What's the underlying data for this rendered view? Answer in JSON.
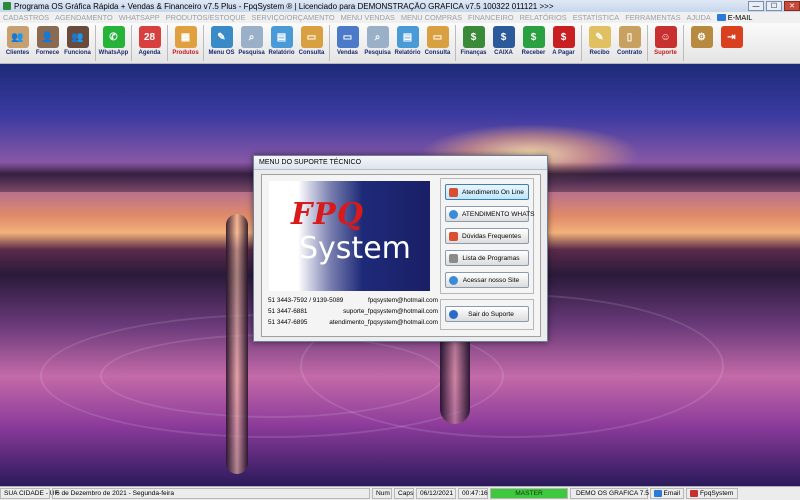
{
  "window": {
    "title": "Programa OS Gráfica Rápida + Vendas & Financeiro v7.5 Plus - FpqSystem ® | Licenciado para  DEMONSTRAÇÃO GRAFICA v7.5 100322 011121 >>>",
    "min_label": "—",
    "max_label": "☐",
    "close_label": "✕"
  },
  "menu": {
    "items": [
      "CADASTROS",
      "AGENDAMENTO",
      "WHATSAPP",
      "PRODUTOS/ESTOQUE",
      "SERVIÇO/ORÇAMENTO",
      "MENU VENDAS",
      "MENU COMPRAS",
      "FINANCEIRO",
      "RELATÓRIOS",
      "ESTATÍSTICA",
      "FERRAMENTAS",
      "AJUDA"
    ],
    "email_label": "E-MAIL"
  },
  "toolbar": {
    "buttons": [
      {
        "label": "Clientes",
        "icon": "clients-icon",
        "color": "#c8a070",
        "glyph": "👥",
        "red": false
      },
      {
        "label": "Fornece",
        "icon": "suppliers-icon",
        "color": "#8a6a50",
        "glyph": "👤",
        "red": false
      },
      {
        "label": "Funciona",
        "icon": "employees-icon",
        "color": "#6a4a3a",
        "glyph": "👥",
        "red": false
      },
      {
        "label": "WhatsApp",
        "icon": "whatsapp-icon",
        "color": "#25b33a",
        "glyph": "✆",
        "red": false
      },
      {
        "label": "Agenda",
        "icon": "calendar-icon",
        "color": "#d84040",
        "glyph": "28",
        "red": false
      },
      {
        "label": "Produtos",
        "icon": "products-icon",
        "color": "#e0a040",
        "glyph": "▦",
        "red": true
      },
      {
        "label": "Menu OS",
        "icon": "service-order-icon",
        "color": "#3a8ac8",
        "glyph": "✎",
        "red": false
      },
      {
        "label": "Pesquisa",
        "icon": "search-doc-icon",
        "color": "#9ab0c8",
        "glyph": "⌕",
        "red": false
      },
      {
        "label": "Relatório",
        "icon": "report-icon",
        "color": "#4a9ad8",
        "glyph": "▤",
        "red": false
      },
      {
        "label": "Consulta",
        "icon": "folder-icon",
        "color": "#d8a040",
        "glyph": "▭",
        "red": false
      },
      {
        "label": "Vendas",
        "icon": "sales-monitor-icon",
        "color": "#4a7ac8",
        "glyph": "▭",
        "red": false
      },
      {
        "label": "Pesquisa",
        "icon": "search-doc-icon",
        "color": "#9ab0c8",
        "glyph": "⌕",
        "red": false
      },
      {
        "label": "Relatório",
        "icon": "report-icon",
        "color": "#4a9ad8",
        "glyph": "▤",
        "red": false
      },
      {
        "label": "Consulta",
        "icon": "folder-icon",
        "color": "#d8a040",
        "glyph": "▭",
        "red": false
      },
      {
        "label": "Finanças",
        "icon": "finance-globe-icon",
        "color": "#3a8a3a",
        "glyph": "$",
        "red": false
      },
      {
        "label": "CAIXA",
        "icon": "cash-register-icon",
        "color": "#2a5a9a",
        "glyph": "$",
        "red": false
      },
      {
        "label": "Receber",
        "icon": "receive-money-icon",
        "color": "#2aa040",
        "glyph": "$",
        "red": false
      },
      {
        "label": "A Pagar",
        "icon": "pay-money-icon",
        "color": "#c82020",
        "glyph": "$",
        "red": false
      },
      {
        "label": "Recibo",
        "icon": "receipt-icon",
        "color": "#e0c060",
        "glyph": "✎",
        "red": false
      },
      {
        "label": "Contrato",
        "icon": "contract-scroll-icon",
        "color": "#c8a060",
        "glyph": "▯",
        "red": false
      },
      {
        "label": "Suporte",
        "icon": "support-icon",
        "color": "#c83030",
        "glyph": "☺",
        "red": true
      },
      {
        "label": "",
        "icon": "settings-coin-icon",
        "color": "#b88a40",
        "glyph": "⚙",
        "red": false
      },
      {
        "label": "",
        "icon": "exit-door-icon",
        "color": "#d84020",
        "glyph": "⇥",
        "red": false
      }
    ]
  },
  "dialog": {
    "title": "MENU DO SUPORTE TÉCNICO",
    "logo_top": "FPQ",
    "logo_bottom": "System",
    "contacts": [
      {
        "phone": "51 3443-7592 / 9139-5089",
        "email": "fpqsystem@hotmail.com"
      },
      {
        "phone": "51 3447-6881",
        "email": "suporte_fpqsystem@hotmail.com"
      },
      {
        "phone": "51 3447-6895",
        "email": "atendimento_fpqsystem@hotmail.com"
      }
    ],
    "buttons": [
      {
        "label": "Atendimento On Line",
        "icon": "online-support-icon",
        "color": "#d85030"
      },
      {
        "label": "ATENDIMENTO WHATS",
        "icon": "chat-bubble-icon",
        "color": "#3a8ad8"
      },
      {
        "label": "Dúvidas Frequentes",
        "icon": "faq-icon",
        "color": "#d85030"
      },
      {
        "label": "Lista de Programas",
        "icon": "program-list-icon",
        "color": "#8a8a8a"
      },
      {
        "label": "Acessar nosso Site",
        "icon": "globe-icon",
        "color": "#3a8ad8"
      }
    ],
    "exit_button": {
      "label": "Sair do Suporte",
      "icon": "exit-circle-icon",
      "color": "#2a6ac8"
    }
  },
  "statusbar": {
    "city": "SUA CIDADE - UF",
    "date_text": "6 de Dezembro de 2021 - Segunda-feira",
    "num": "Num",
    "caps": "Caps",
    "date": "06/12/2021",
    "time": "00:47:16",
    "user": "MASTER",
    "company": "DEMO OS GRAFICA 7.5",
    "email": "Email",
    "brand": "FpqSystem"
  }
}
